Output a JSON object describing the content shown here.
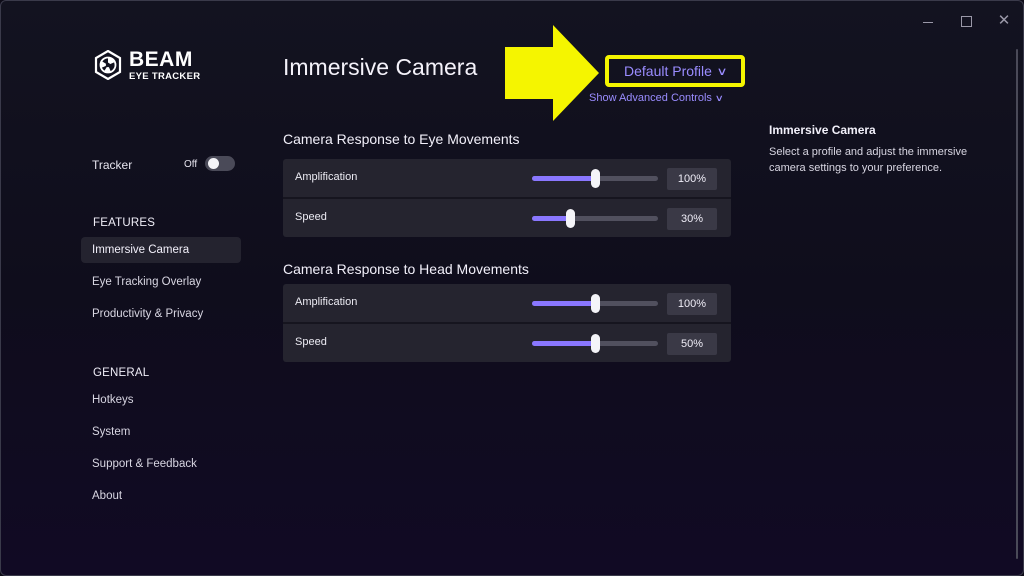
{
  "window": {
    "controls": {
      "minimize_icon": "minimize-icon",
      "maximize_icon": "maximize-icon",
      "close_glyph": "✕"
    }
  },
  "brand": {
    "name": "BEAM",
    "subtitle": "EYE TRACKER"
  },
  "sidebar": {
    "tracker": {
      "label": "Tracker",
      "state": "Off",
      "enabled": false
    },
    "sections": [
      {
        "header": "FEATURES",
        "items": [
          {
            "label": "Immersive Camera",
            "active": true
          },
          {
            "label": "Eye Tracking Overlay",
            "active": false
          },
          {
            "label": "Productivity & Privacy",
            "active": false
          }
        ]
      },
      {
        "header": "GENERAL",
        "items": [
          {
            "label": "Hotkeys",
            "active": false
          },
          {
            "label": "System",
            "active": false
          },
          {
            "label": "Support & Feedback",
            "active": false
          },
          {
            "label": "About",
            "active": false
          }
        ]
      }
    ]
  },
  "main": {
    "title": "Immersive Camera",
    "profile": {
      "label": "Default Profile",
      "chevron": "∨"
    },
    "advanced": {
      "label": "Show Advanced Controls",
      "chevron": "∨"
    },
    "groups": [
      {
        "title": "Camera Response to Eye Movements",
        "rows": [
          {
            "label": "Amplification",
            "value_text": "100%",
            "level": 0.5
          },
          {
            "label": "Speed",
            "value_text": "30%",
            "level": 0.3
          }
        ]
      },
      {
        "title": "Camera Response to Head Movements",
        "rows": [
          {
            "label": "Amplification",
            "value_text": "100%",
            "level": 0.5
          },
          {
            "label": "Speed",
            "value_text": "50%",
            "level": 0.5
          }
        ]
      }
    ]
  },
  "info": {
    "title": "Immersive Camera",
    "description": "Select a profile and adjust the immersive camera settings to your preference."
  },
  "colors": {
    "accent": "#8a77ff",
    "highlight": "#f5f500",
    "panel": "#25242f"
  }
}
